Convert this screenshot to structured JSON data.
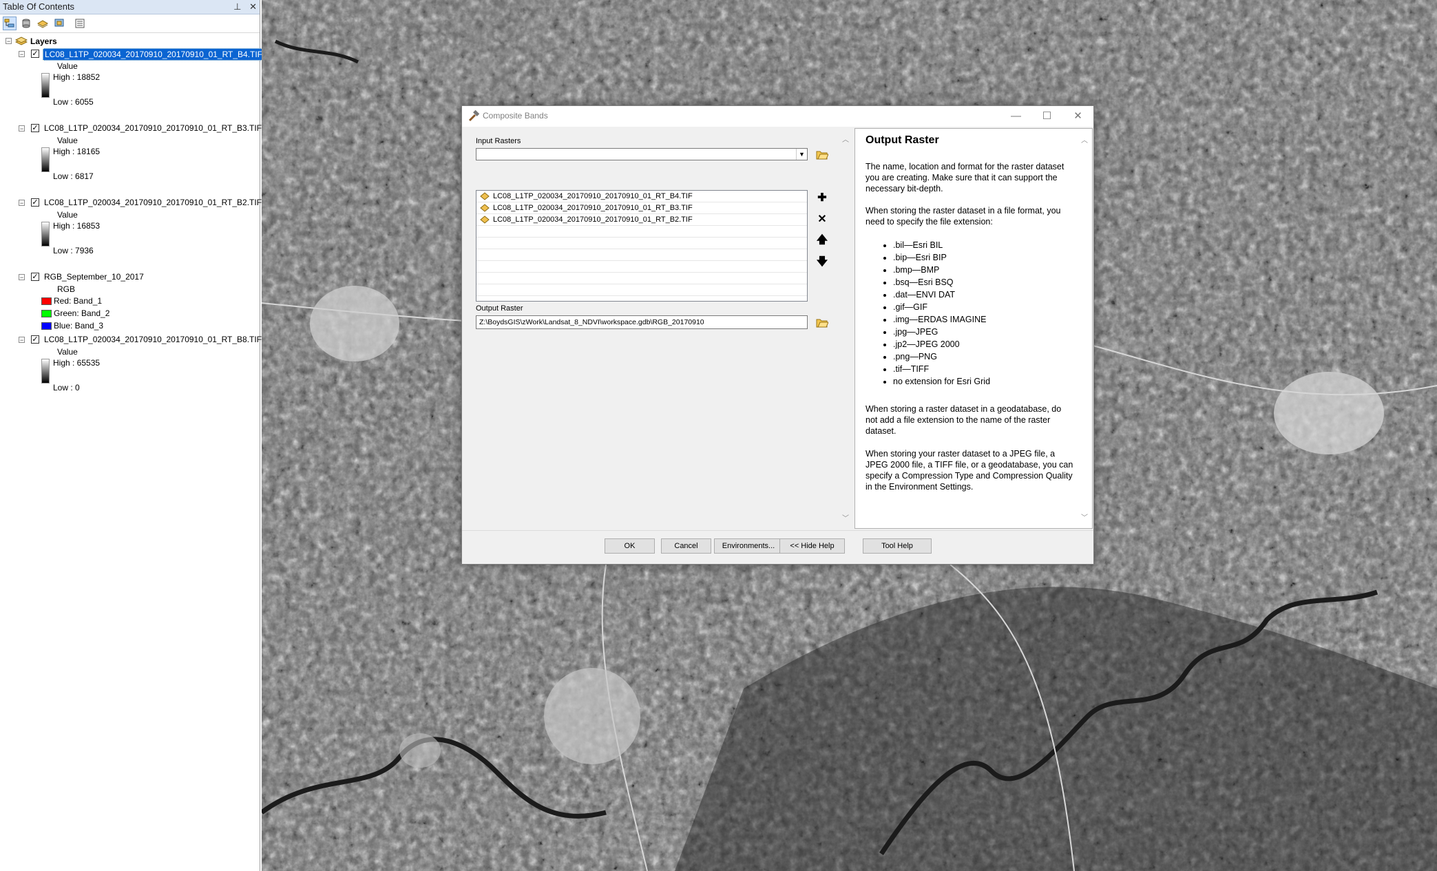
{
  "toc": {
    "title": "Table Of Contents",
    "header_icons": [
      "pin-icon",
      "close-icon"
    ],
    "tools": [
      "list-by-drawing-order-icon",
      "list-by-source-icon",
      "list-by-visibility-icon",
      "list-by-selection-icon",
      "options-icon"
    ],
    "root_label": "Layers",
    "layers": [
      {
        "name": "LC08_L1TP_020034_20170910_20170910_01_RT_B4.TIF",
        "checked": true,
        "selected": true,
        "legend_header": "Value",
        "high": "High : 18852",
        "low": "Low : 6055"
      },
      {
        "name": "LC08_L1TP_020034_20170910_20170910_01_RT_B3.TIF",
        "checked": true,
        "legend_header": "Value",
        "high": "High : 18165",
        "low": "Low : 6817"
      },
      {
        "name": "LC08_L1TP_020034_20170910_20170910_01_RT_B2.TIF",
        "checked": true,
        "legend_header": "Value",
        "high": "High : 16853",
        "low": "Low : 7936"
      },
      {
        "name": "RGB_September_10_2017",
        "checked": true,
        "legend_header": "RGB",
        "bands": [
          {
            "label": "Red:   Band_1",
            "color": "#ff0000"
          },
          {
            "label": "Green: Band_2",
            "color": "#00ff00"
          },
          {
            "label": "Blue:   Band_3",
            "color": "#0000ff"
          }
        ]
      },
      {
        "name": "LC08_L1TP_020034_20170910_20170910_01_RT_B8.TIF",
        "checked": true,
        "legend_header": "Value",
        "high": "High : 65535",
        "low": "Low : 0"
      }
    ]
  },
  "dialog": {
    "title": "Composite Bands",
    "input_rasters_label": "Input Rasters",
    "input_rasters": [
      "LC08_L1TP_020034_20170910_20170910_01_RT_B4.TIF",
      "LC08_L1TP_020034_20170910_20170910_01_RT_B3.TIF",
      "LC08_L1TP_020034_20170910_20170910_01_RT_B2.TIF"
    ],
    "output_raster_label": "Output Raster",
    "output_raster_value": "Z:\\BoydsGIS\\zWork\\Landsat_8_NDVI\\workspace.gdb\\RGB_20170910",
    "buttons": {
      "ok": "OK",
      "cancel": "Cancel",
      "environments": "Environments...",
      "hide_help": "<< Hide Help",
      "tool_help": "Tool Help"
    },
    "help": {
      "title": "Output Raster",
      "p1": "The name, location and format for the raster dataset you are creating. Make sure that it can support the necessary bit-depth.",
      "p2": "When storing the raster dataset in a file format, you need to specify the file extension:",
      "extensions": [
        ".bil—Esri BIL",
        ".bip—Esri BIP",
        ".bmp—BMP",
        ".bsq—Esri BSQ",
        ".dat—ENVI DAT",
        ".gif—GIF",
        ".img—ERDAS IMAGINE",
        ".jpg—JPEG",
        ".jp2—JPEG 2000",
        ".png—PNG",
        ".tif—TIFF",
        "no extension for Esri Grid"
      ],
      "p3": "When storing a raster dataset in a geodatabase, do not add a file extension to the name of the raster dataset.",
      "p4": "When storing your raster dataset to a JPEG file, a JPEG 2000 file, a TIFF file, or a geodatabase, you can specify a Compression Type and Compression Quality in the Environment Settings."
    }
  },
  "colors": {
    "selection": "#0a64d2",
    "toc_titlebar": "#dbe6f4"
  }
}
